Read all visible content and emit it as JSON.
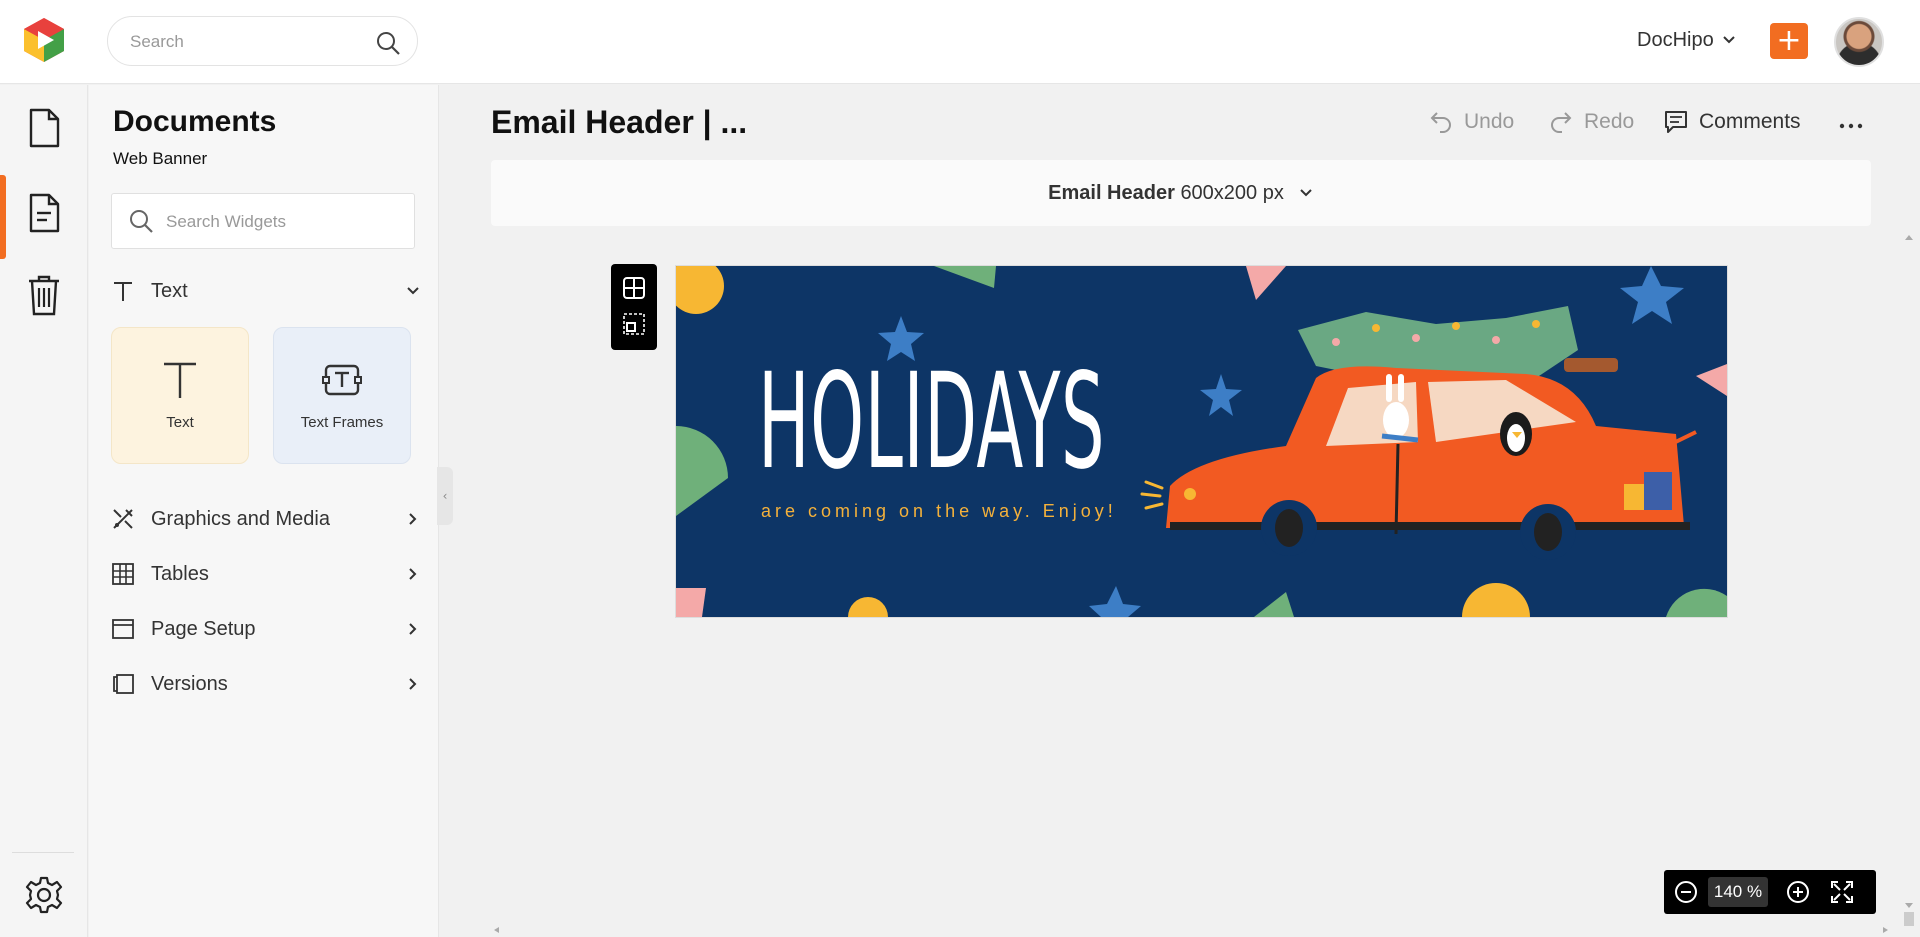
{
  "header": {
    "search_placeholder": "Search",
    "workspace_label": "DocHipo",
    "plus_label": "+",
    "accent_color": "#f26d21"
  },
  "rail": {
    "items": [
      {
        "name": "documents-icon"
      },
      {
        "name": "current-document-icon",
        "active": true
      },
      {
        "name": "trash-icon"
      },
      {
        "name": "settings-icon"
      }
    ]
  },
  "panel": {
    "title": "Documents",
    "subtitle": "Web Banner",
    "widget_search_placeholder": "Search Widgets",
    "text_section_label": "Text",
    "tiles": [
      {
        "label": "Text",
        "icon": "text-icon"
      },
      {
        "label": "Text Frames",
        "icon": "text-frame-icon"
      }
    ],
    "sections": [
      {
        "label": "Graphics and Media",
        "icon": "graphics-icon"
      },
      {
        "label": "Tables",
        "icon": "table-icon"
      },
      {
        "label": "Page Setup",
        "icon": "page-setup-icon"
      },
      {
        "label": "Versions",
        "icon": "versions-icon"
      }
    ]
  },
  "main": {
    "doc_title": "Email Header | ...",
    "undo_label": "Undo",
    "redo_label": "Redo",
    "comments_label": "Comments",
    "size_name": "Email Header",
    "size_value": "600x200 px",
    "zoom_value": "140 %"
  },
  "design": {
    "headline": "HOLIDAYS",
    "tagline": "are coming on the way. Enjoy!",
    "background_color": "#0d3566",
    "tagline_color": "#f4b13b",
    "car_color": "#f25a22"
  }
}
